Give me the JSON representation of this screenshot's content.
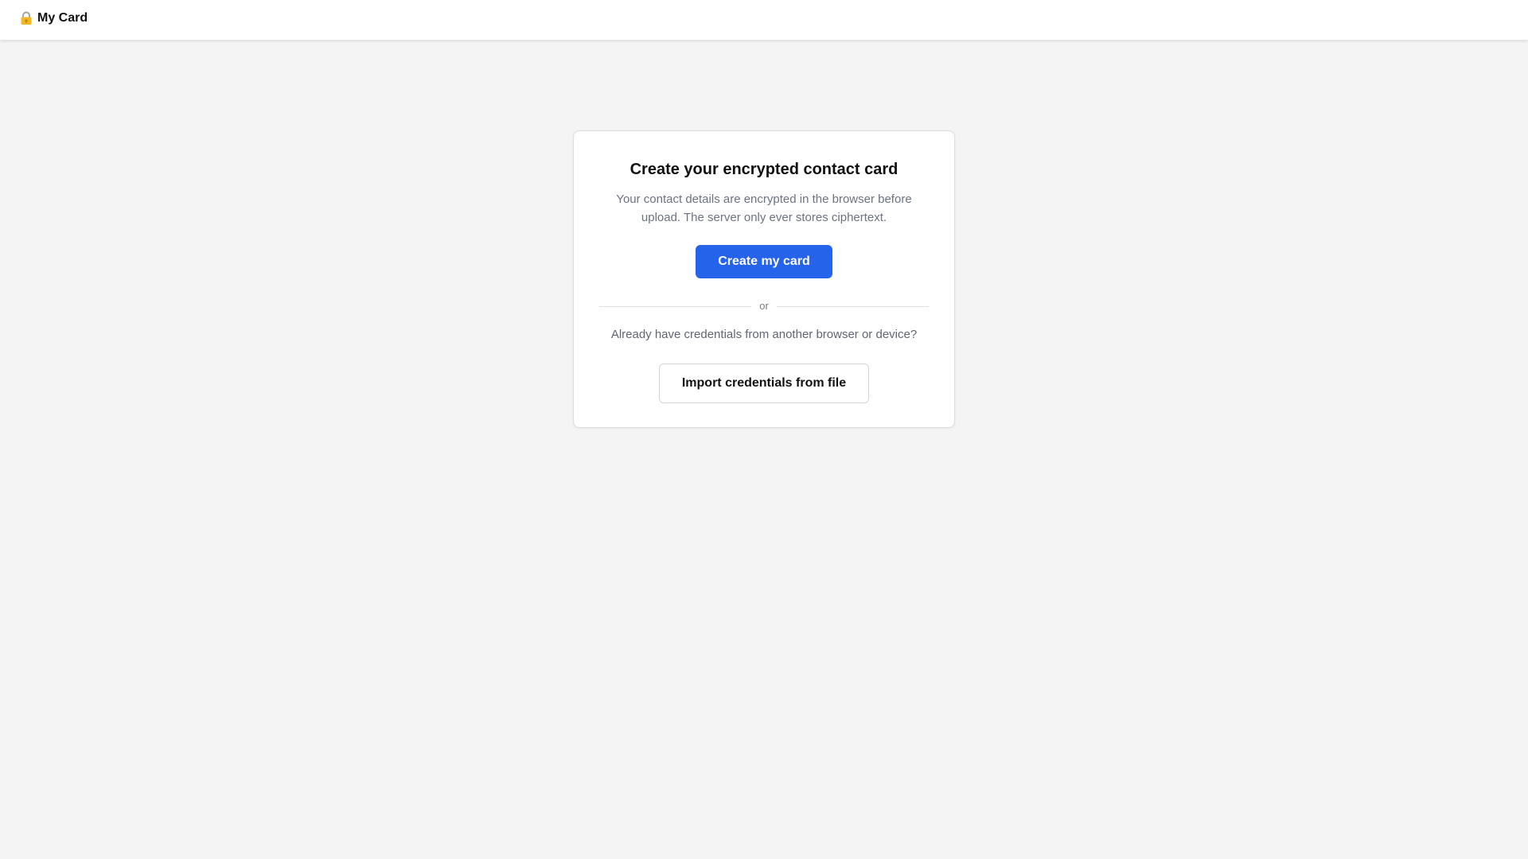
{
  "app": {
    "icon": "lock-with-key-icon",
    "title": "My Card"
  },
  "card": {
    "title": "Create your encrypted contact card",
    "description": "Your contact details are encrypted in the browser before upload. The server only ever stores ciphertext.",
    "create_button_label": "Create my card",
    "divider_label": "or",
    "import_prompt": "Already have credentials from another browser or device?",
    "import_button_label": "Import credentials from file"
  },
  "colors": {
    "primary": "#2563eb",
    "background": "#f4f4f4",
    "surface": "#ffffff",
    "muted_text": "#6b7280"
  }
}
